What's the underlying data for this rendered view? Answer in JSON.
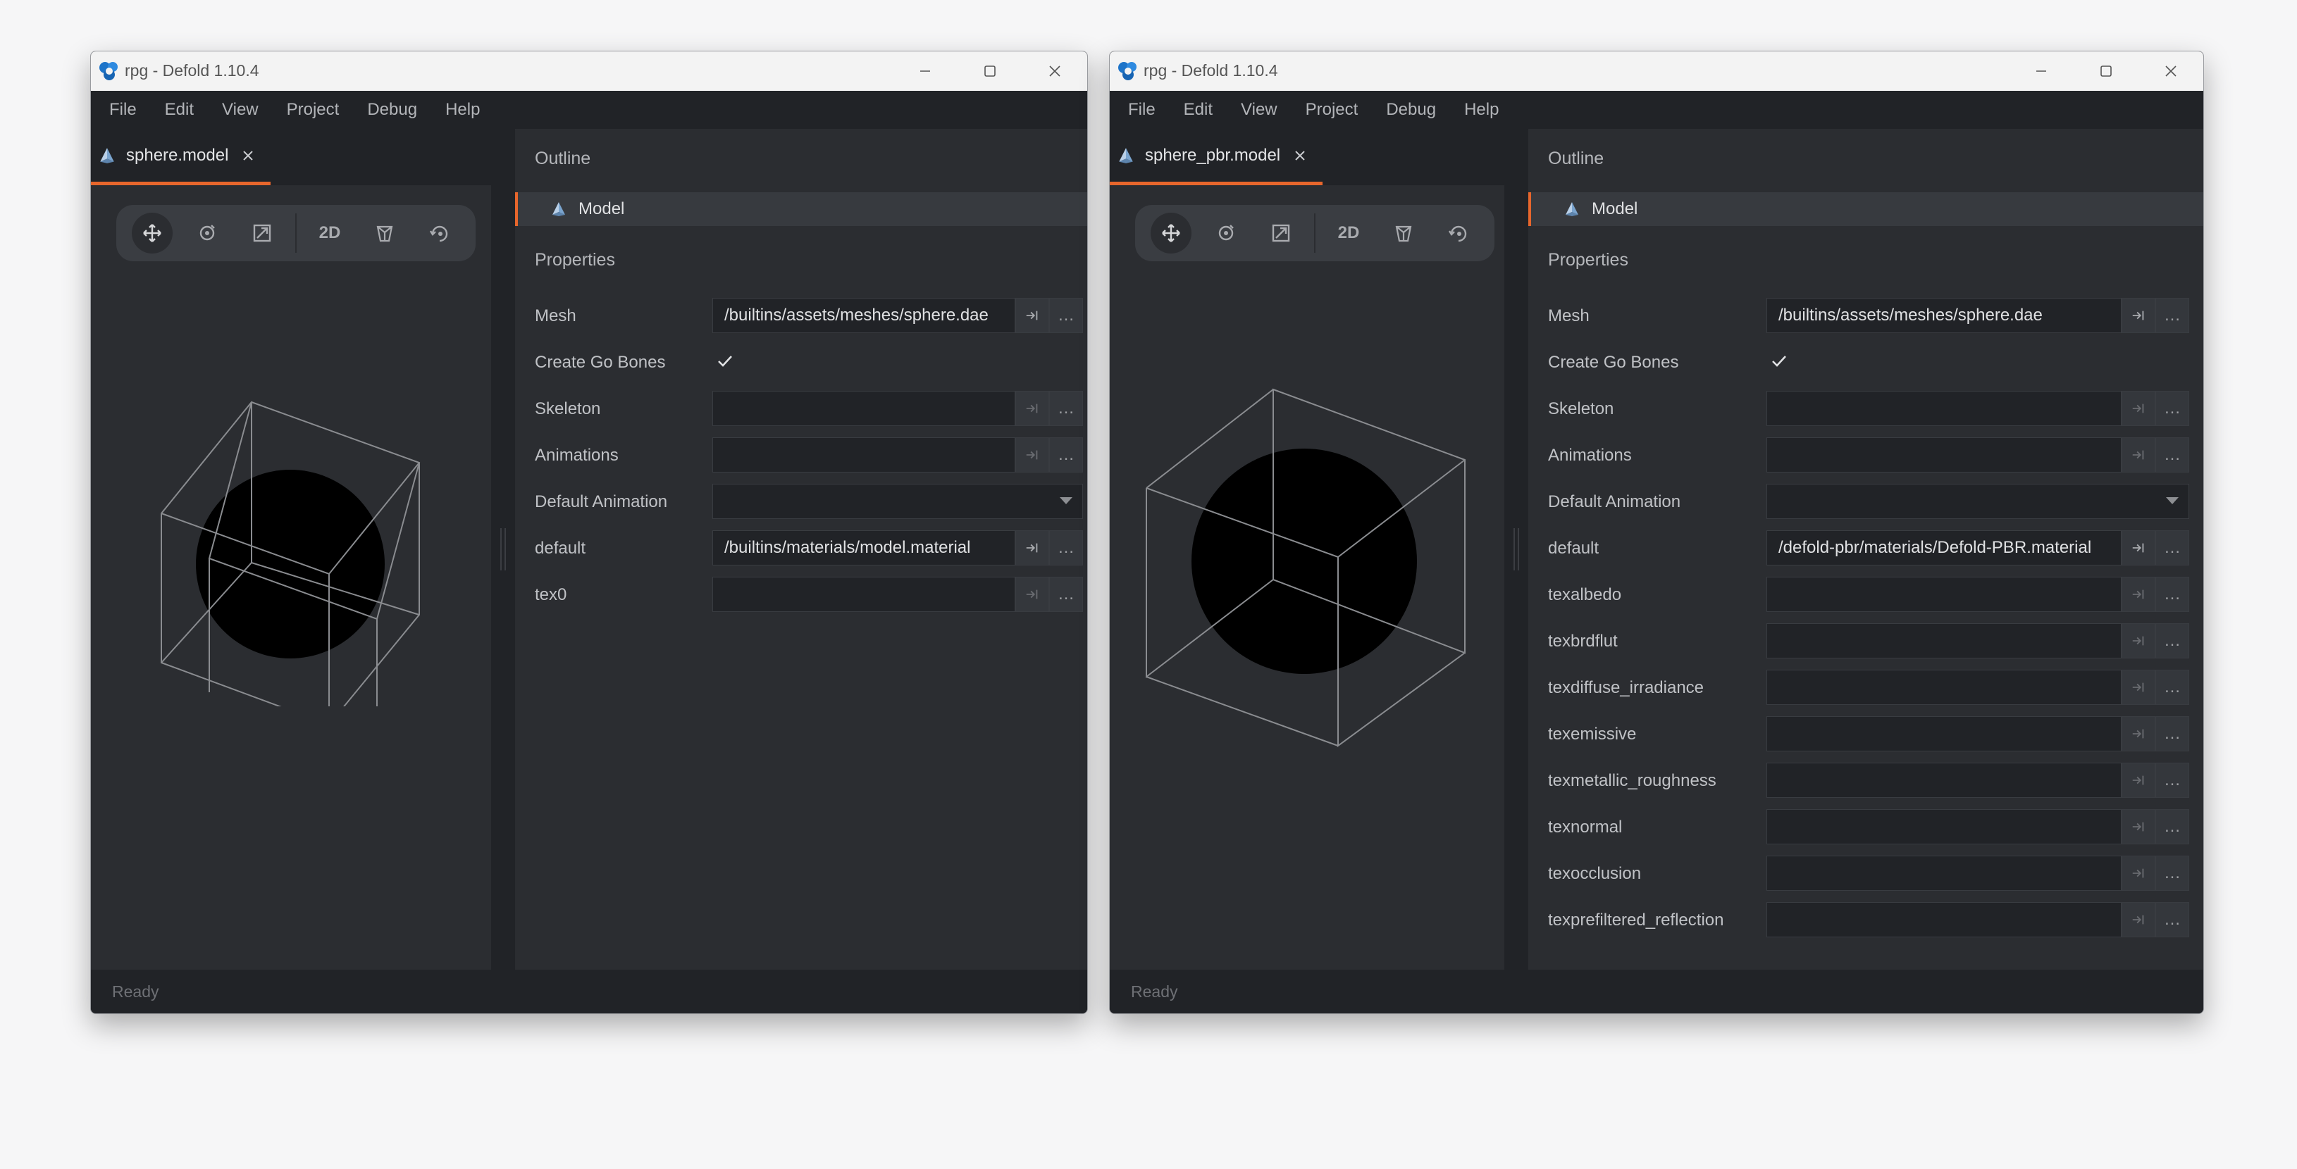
{
  "colors": {
    "accent": "#e7662c",
    "panel": "#2b2d31",
    "header": "#212327"
  },
  "windows": [
    {
      "title": "rpg - Defold 1.10.4",
      "menu": [
        "File",
        "Edit",
        "View",
        "Project",
        "Debug",
        "Help"
      ],
      "tab": "sphere.model",
      "toolbar_2d": "2D",
      "outline_title": "Outline",
      "outline_item": "Model",
      "properties_title": "Properties",
      "properties": [
        {
          "label": "Mesh",
          "value": "/builtins/assets/meshes/sphere.dae"
        },
        {
          "label": "Create Go Bones",
          "value": ""
        },
        {
          "label": "Skeleton",
          "value": ""
        },
        {
          "label": "Animations",
          "value": ""
        },
        {
          "label": "Default Animation",
          "value": ""
        },
        {
          "label": "default",
          "value": "/builtins/materials/model.material"
        },
        {
          "label": "tex0",
          "value": ""
        }
      ],
      "status": "Ready"
    },
    {
      "title": "rpg - Defold 1.10.4",
      "menu": [
        "File",
        "Edit",
        "View",
        "Project",
        "Debug",
        "Help"
      ],
      "tab": "sphere_pbr.model",
      "toolbar_2d": "2D",
      "outline_title": "Outline",
      "outline_item": "Model",
      "properties_title": "Properties",
      "properties": [
        {
          "label": "Mesh",
          "value": "/builtins/assets/meshes/sphere.dae"
        },
        {
          "label": "Create Go Bones",
          "value": ""
        },
        {
          "label": "Skeleton",
          "value": ""
        },
        {
          "label": "Animations",
          "value": ""
        },
        {
          "label": "Default Animation",
          "value": ""
        },
        {
          "label": "default",
          "value": "/defold-pbr/materials/Defold-PBR.material"
        },
        {
          "label": "texalbedo",
          "value": ""
        },
        {
          "label": "texbrdflut",
          "value": ""
        },
        {
          "label": "texdiffuse_irradiance",
          "value": ""
        },
        {
          "label": "texemissive",
          "value": ""
        },
        {
          "label": "texmetallic_roughness",
          "value": ""
        },
        {
          "label": "texnormal",
          "value": ""
        },
        {
          "label": "texocclusion",
          "value": ""
        },
        {
          "label": "texprefiltered_reflection",
          "value": ""
        }
      ],
      "status": "Ready"
    }
  ],
  "placeholder_dots": "…"
}
